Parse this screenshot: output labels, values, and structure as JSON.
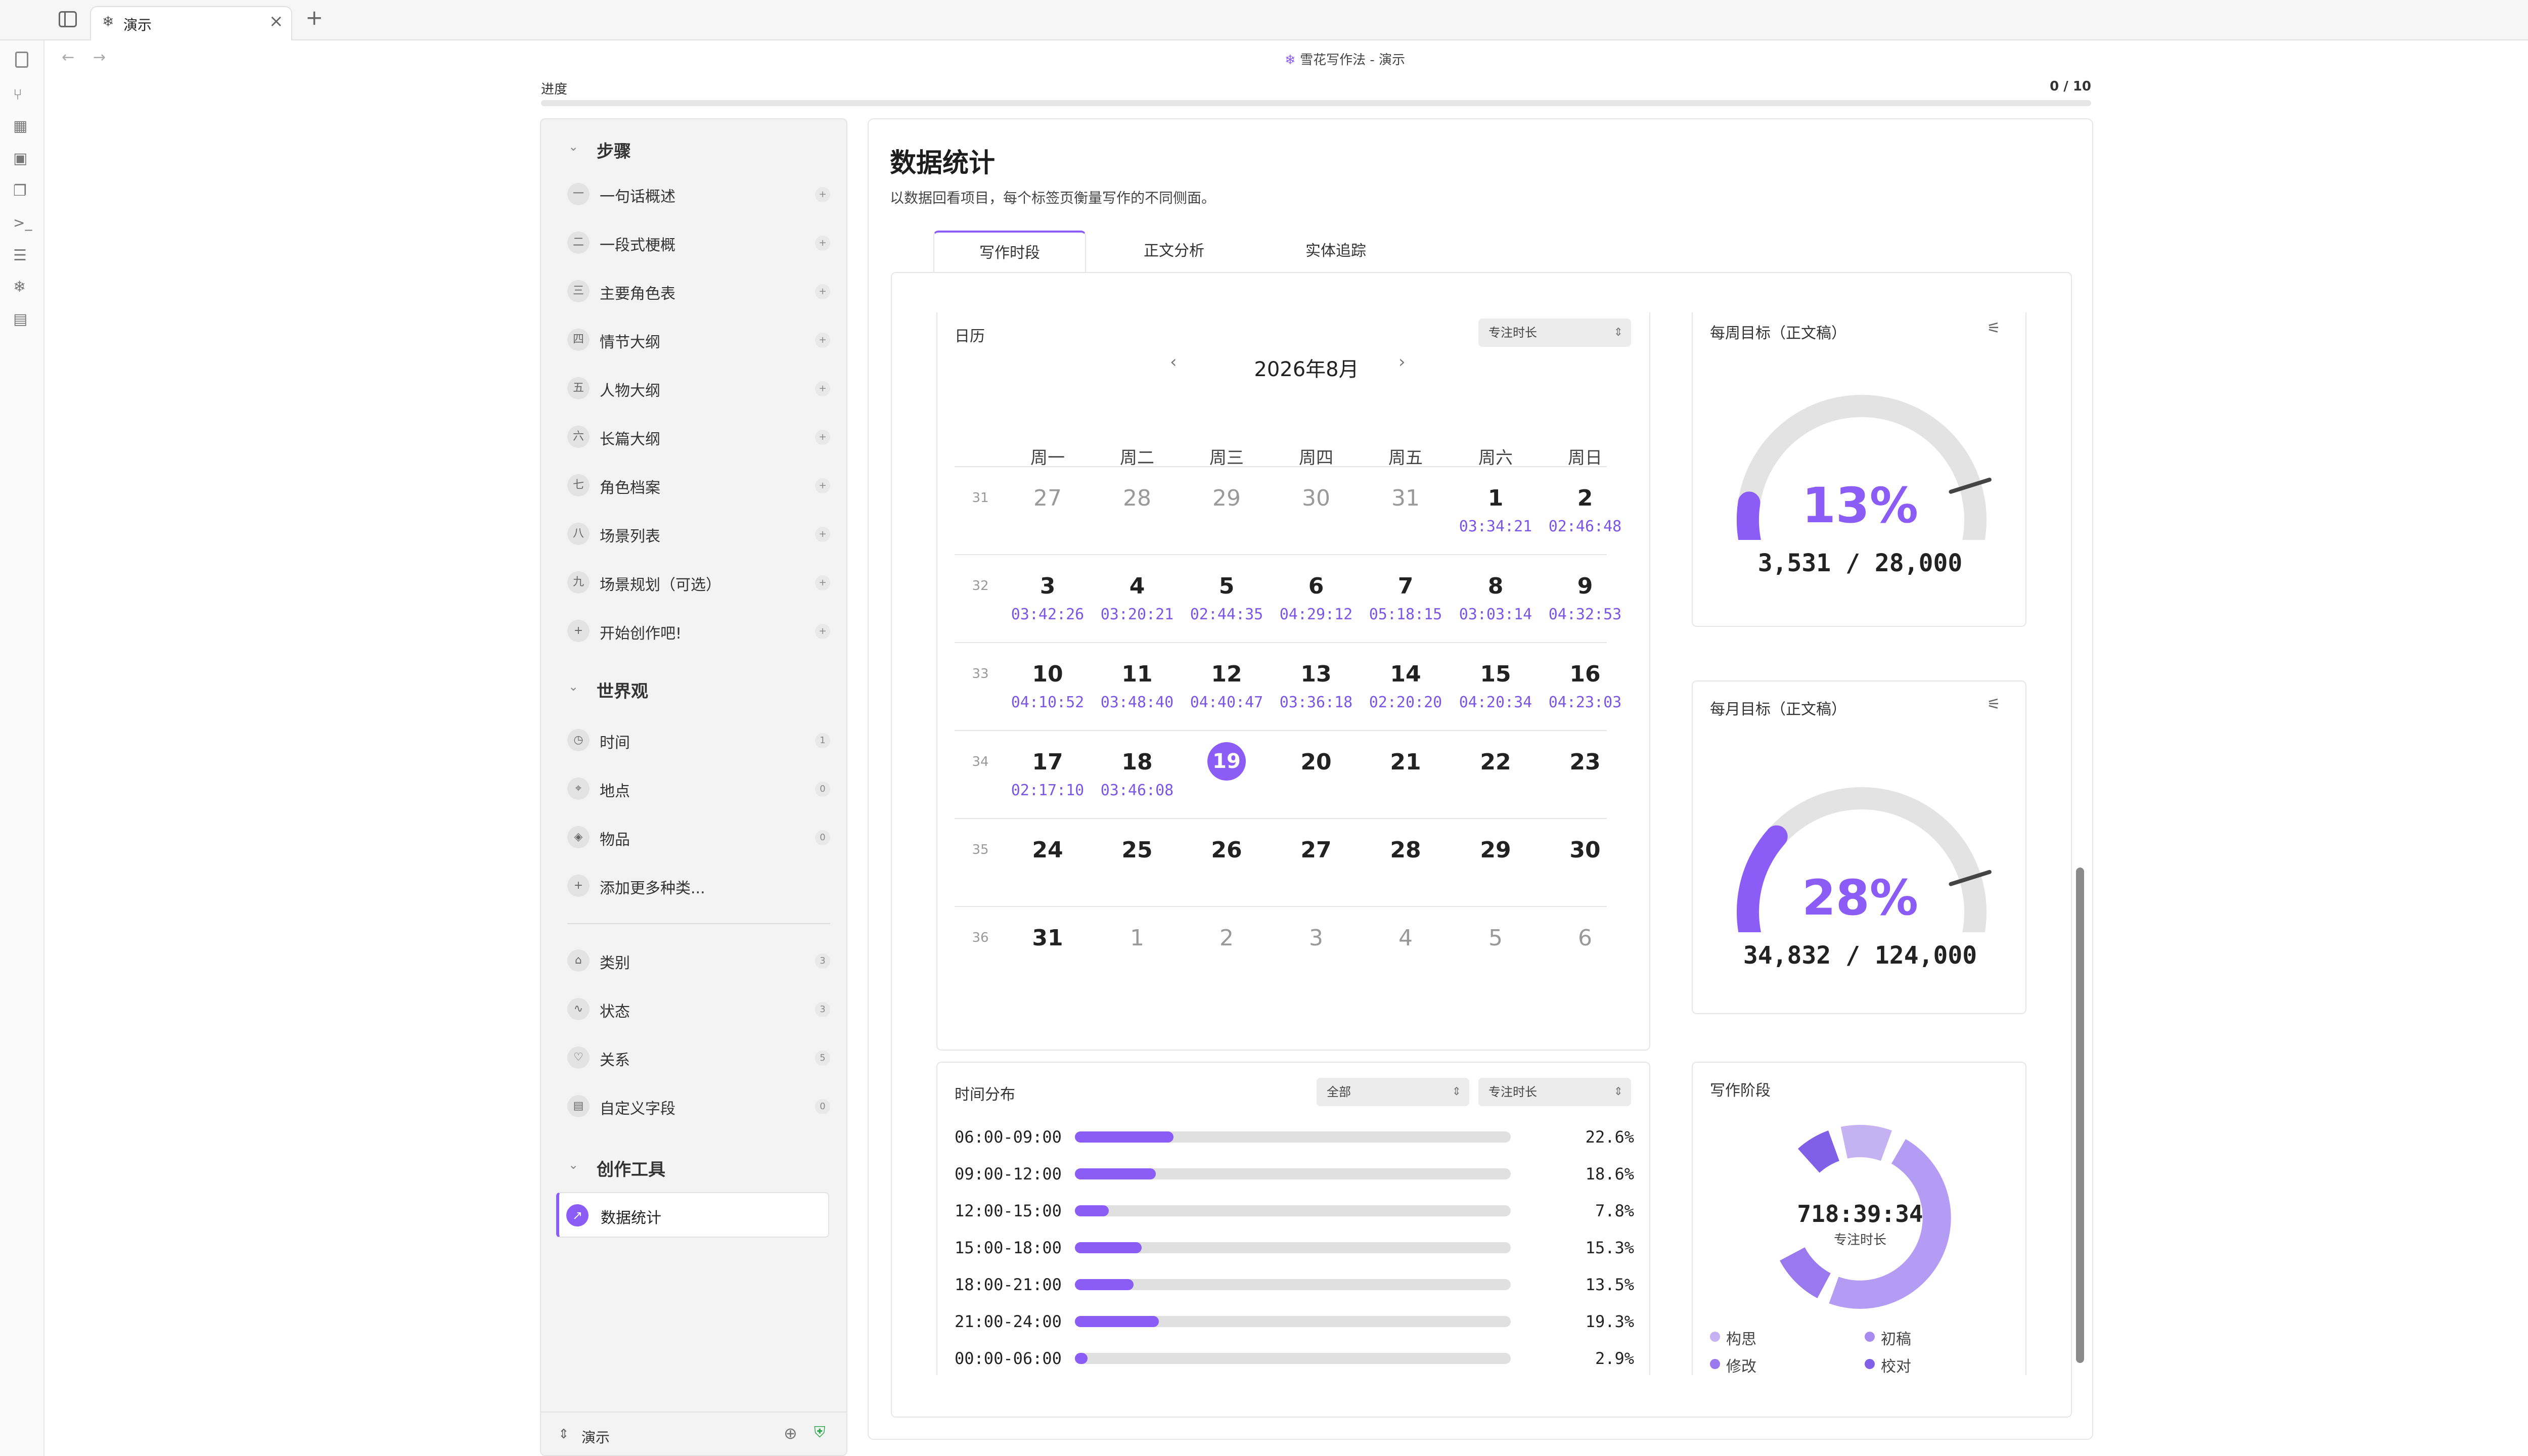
{
  "window": {
    "tab_label": "演示",
    "doc_title": "雪花写作法 - 演示",
    "progress_label": "进度",
    "progress_value": "0 / 10",
    "progress_fraction": 0
  },
  "sidebar": {
    "steps_header": "步骤",
    "steps": [
      {
        "num": "一",
        "label": "一句话概述"
      },
      {
        "num": "二",
        "label": "一段式梗概"
      },
      {
        "num": "三",
        "label": "主要角色表"
      },
      {
        "num": "四",
        "label": "情节大纲"
      },
      {
        "num": "五",
        "label": "人物大纲"
      },
      {
        "num": "六",
        "label": "长篇大纲"
      },
      {
        "num": "七",
        "label": "角色档案"
      },
      {
        "num": "八",
        "label": "场景列表"
      },
      {
        "num": "九",
        "label": "场景规划（可选）"
      },
      {
        "num": "+",
        "label": "开始创作吧!"
      }
    ],
    "world_header": "世界观",
    "world_items": [
      {
        "label": "时间",
        "count": "1",
        "icon": "clock-icon"
      },
      {
        "label": "地点",
        "count": "0",
        "icon": "pin-icon"
      },
      {
        "label": "物品",
        "count": "0",
        "icon": "gem-icon"
      },
      {
        "label": "添加更多种类...",
        "count": "",
        "icon": "plus-icon"
      }
    ],
    "meta_items": [
      {
        "label": "类别",
        "count": "3",
        "icon": "tag-icon"
      },
      {
        "label": "状态",
        "count": "3",
        "icon": "pulse-icon"
      },
      {
        "label": "关系",
        "count": "5",
        "icon": "heart-icon"
      },
      {
        "label": "自定义字段",
        "count": "0",
        "icon": "field-icon"
      }
    ],
    "tools_header": "创作工具",
    "tools_active": "数据统计",
    "footer_label": "演示"
  },
  "main": {
    "title": "数据统计",
    "subtitle": "以数据回看项目，每个标签页衡量写作的不同侧面。",
    "tabs": [
      "写作时段",
      "正文分析",
      "实体追踪"
    ],
    "active_tab": 0
  },
  "calendar": {
    "title": "日历",
    "select": "专注时长",
    "month": "2026年8月",
    "weekdays": [
      "周一",
      "周二",
      "周三",
      "周四",
      "周五",
      "周六",
      "周日"
    ],
    "today": "19",
    "weeks": [
      {
        "wk": "31",
        "days": [
          {
            "d": "27",
            "dim": true,
            "t": ""
          },
          {
            "d": "28",
            "dim": true,
            "t": ""
          },
          {
            "d": "29",
            "dim": true,
            "t": ""
          },
          {
            "d": "30",
            "dim": true,
            "t": ""
          },
          {
            "d": "31",
            "dim": true,
            "t": ""
          },
          {
            "d": "1",
            "dim": false,
            "t": "03:34:21"
          },
          {
            "d": "2",
            "dim": false,
            "t": "02:46:48"
          }
        ]
      },
      {
        "wk": "32",
        "days": [
          {
            "d": "3",
            "dim": false,
            "t": "03:42:26"
          },
          {
            "d": "4",
            "dim": false,
            "t": "03:20:21"
          },
          {
            "d": "5",
            "dim": false,
            "t": "02:44:35"
          },
          {
            "d": "6",
            "dim": false,
            "t": "04:29:12"
          },
          {
            "d": "7",
            "dim": false,
            "t": "05:18:15"
          },
          {
            "d": "8",
            "dim": false,
            "t": "03:03:14"
          },
          {
            "d": "9",
            "dim": false,
            "t": "04:32:53"
          }
        ]
      },
      {
        "wk": "33",
        "days": [
          {
            "d": "10",
            "dim": false,
            "t": "04:10:52"
          },
          {
            "d": "11",
            "dim": false,
            "t": "03:48:40"
          },
          {
            "d": "12",
            "dim": false,
            "t": "04:40:47"
          },
          {
            "d": "13",
            "dim": false,
            "t": "03:36:18"
          },
          {
            "d": "14",
            "dim": false,
            "t": "02:20:20"
          },
          {
            "d": "15",
            "dim": false,
            "t": "04:20:34"
          },
          {
            "d": "16",
            "dim": false,
            "t": "04:23:03"
          }
        ]
      },
      {
        "wk": "34",
        "days": [
          {
            "d": "17",
            "dim": false,
            "t": "02:17:10"
          },
          {
            "d": "18",
            "dim": false,
            "t": "03:46:08"
          },
          {
            "d": "19",
            "dim": false,
            "t": ""
          },
          {
            "d": "20",
            "dim": false,
            "t": ""
          },
          {
            "d": "21",
            "dim": false,
            "t": ""
          },
          {
            "d": "22",
            "dim": false,
            "t": ""
          },
          {
            "d": "23",
            "dim": false,
            "t": ""
          }
        ]
      },
      {
        "wk": "35",
        "days": [
          {
            "d": "24",
            "dim": false,
            "t": ""
          },
          {
            "d": "25",
            "dim": false,
            "t": ""
          },
          {
            "d": "26",
            "dim": false,
            "t": ""
          },
          {
            "d": "27",
            "dim": false,
            "t": ""
          },
          {
            "d": "28",
            "dim": false,
            "t": ""
          },
          {
            "d": "29",
            "dim": false,
            "t": ""
          },
          {
            "d": "30",
            "dim": false,
            "t": ""
          }
        ]
      },
      {
        "wk": "36",
        "days": [
          {
            "d": "31",
            "dim": false,
            "t": ""
          },
          {
            "d": "1",
            "dim": true,
            "t": ""
          },
          {
            "d": "2",
            "dim": true,
            "t": ""
          },
          {
            "d": "3",
            "dim": true,
            "t": ""
          },
          {
            "d": "4",
            "dim": true,
            "t": ""
          },
          {
            "d": "5",
            "dim": true,
            "t": ""
          },
          {
            "d": "6",
            "dim": true,
            "t": ""
          }
        ]
      }
    ]
  },
  "weekly_goal": {
    "title": "每周目标（正文稿）",
    "percent": "13%",
    "fraction": 0.13,
    "progress": "3,531 / 28,000"
  },
  "monthly_goal": {
    "title": "每月目标（正文稿）",
    "percent": "28%",
    "fraction": 0.28,
    "progress": "34,832 / 124,000"
  },
  "distribution": {
    "title": "时间分布",
    "select_scope": "全部",
    "select_metric": "专注时长",
    "rows": [
      {
        "range": "06:00-09:00",
        "pct": "22.6%",
        "value": 22.6
      },
      {
        "range": "09:00-12:00",
        "pct": "18.6%",
        "value": 18.6
      },
      {
        "range": "12:00-15:00",
        "pct": "7.8%",
        "value": 7.8
      },
      {
        "range": "15:00-18:00",
        "pct": "15.3%",
        "value": 15.3
      },
      {
        "range": "18:00-21:00",
        "pct": "13.5%",
        "value": 13.5
      },
      {
        "range": "21:00-24:00",
        "pct": "19.3%",
        "value": 19.3
      },
      {
        "range": "00:00-06:00",
        "pct": "2.9%",
        "value": 2.9
      }
    ]
  },
  "phases": {
    "title": "写作阶段",
    "total": "718:39:34",
    "total_label": "专注时长",
    "legend": [
      {
        "label": "构思",
        "color": "#c4b2f3"
      },
      {
        "label": "初稿",
        "color": "#a98af0"
      },
      {
        "label": "修改",
        "color": "#9a78ee"
      },
      {
        "label": "校对",
        "color": "#8060e6"
      }
    ]
  },
  "colors": {
    "accent": "#8b5cf6",
    "track": "#e0e0e0"
  }
}
